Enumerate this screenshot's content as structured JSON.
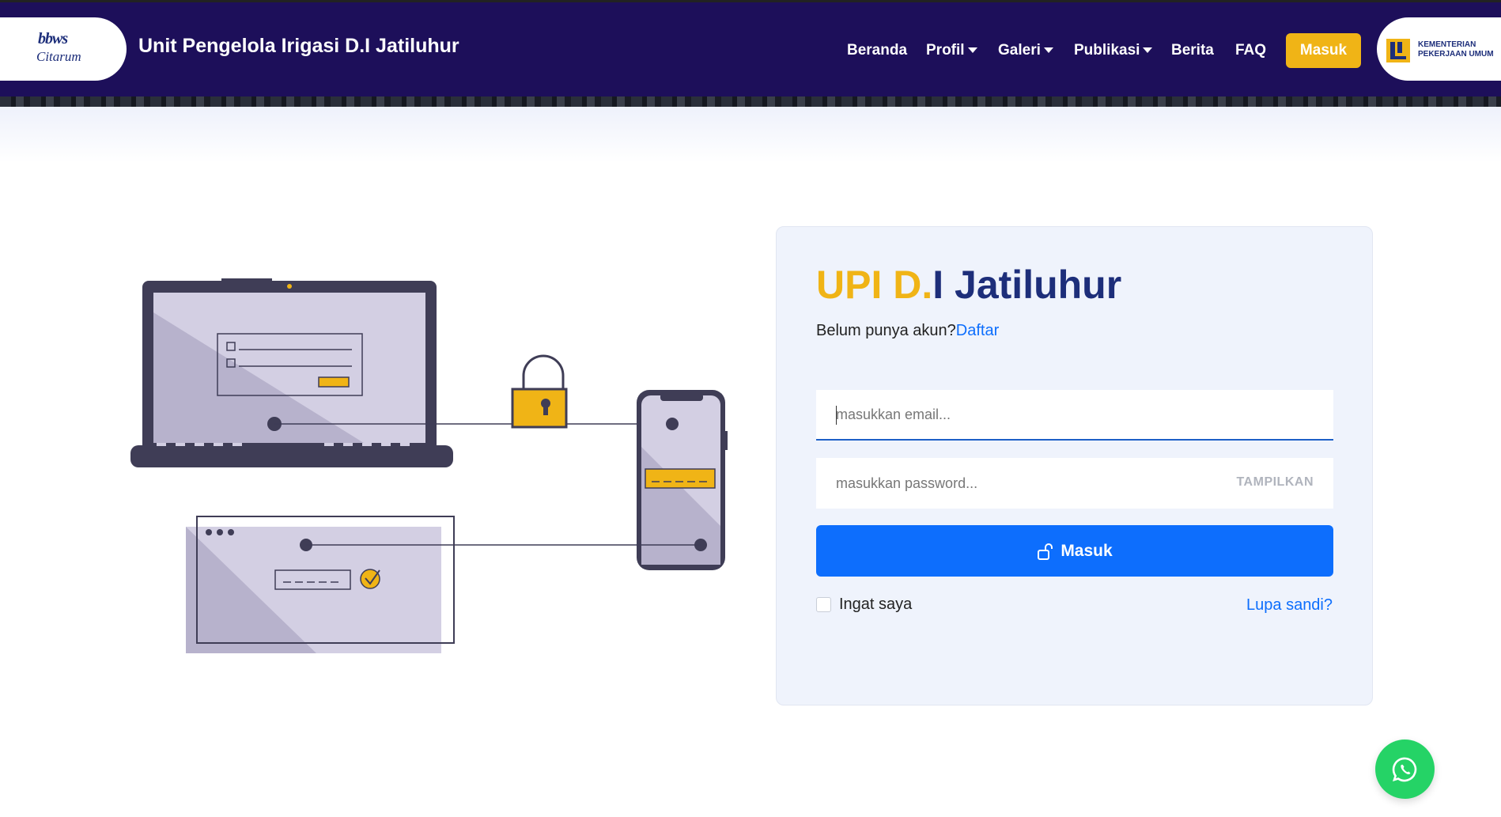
{
  "header": {
    "site_title": "Unit Pengelola Irigasi D.I Jatiluhur",
    "logo_text_top": "bbws",
    "logo_text_bottom": "Citarum",
    "nav": {
      "beranda": "Beranda",
      "profil": "Profil",
      "galeri": "Galeri",
      "publikasi": "Publikasi",
      "berita": "Berita",
      "faq": "FAQ"
    },
    "login_button": "Masuk",
    "ministry_line1": "KEMENTERIAN",
    "ministry_line2": "PEKERJAAN UMUM"
  },
  "login": {
    "title_part1": "UPI D.",
    "title_part2": "I Jatiluhur",
    "signup_prompt": "Belum punya akun?",
    "signup_link": "Daftar",
    "email_placeholder": "masukkan email...",
    "password_placeholder": "masukkan password...",
    "show_password": "TAMPILKAN",
    "submit": "Masuk",
    "remember_me": "Ingat saya",
    "forgot_password": "Lupa sandi?"
  },
  "colors": {
    "header_bg": "#1d0f5a",
    "accent_yellow": "#f0b416",
    "primary_blue": "#0d6efd",
    "card_bg": "#eff3fc",
    "whatsapp_green": "#25d366"
  },
  "icons": {
    "submit_icon": "unlock-icon",
    "floating_button_icon": "whatsapp-icon"
  }
}
